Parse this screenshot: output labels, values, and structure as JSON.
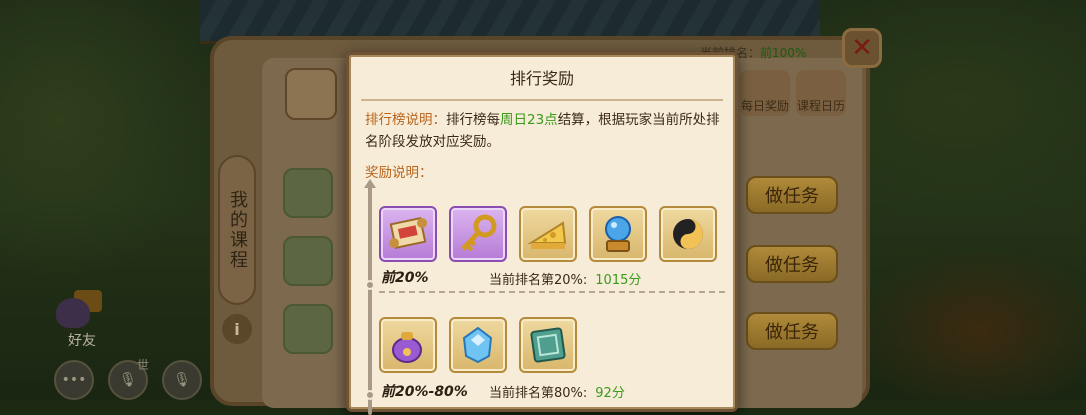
{
  "background": {
    "title_prefix": "当前排名：",
    "title_value": "前100%",
    "tabs": [
      "每日奖励",
      "课程日历"
    ],
    "side_tab_label": "我的课程",
    "info_label": "i",
    "task_button_label": "做任务",
    "friend_label": "好友",
    "world_label": "世"
  },
  "dialog": {
    "title": "排行奖励",
    "desc_label": "排行榜说明：",
    "desc_part1": "排行榜每",
    "desc_highlight": "周日23点",
    "desc_part2": "结算，根据玩家当前所处排名阶段发放对应奖励。",
    "reward_label": "奖励说明："
  },
  "tiers": [
    {
      "name": "前20%",
      "rank_text": "当前排名第20%:",
      "score": "1015分",
      "items": [
        {
          "icon": "scroll-icon",
          "rarity": "purple"
        },
        {
          "icon": "key-icon",
          "rarity": "purple"
        },
        {
          "icon": "cheese-icon",
          "rarity": "gold"
        },
        {
          "icon": "crystal-ball-icon",
          "rarity": "gold"
        },
        {
          "icon": "yin-yang-icon",
          "rarity": "gold"
        }
      ]
    },
    {
      "name": "前20%-80%",
      "rank_text": "当前排名第80%:",
      "score": "92分",
      "items": [
        {
          "icon": "pouch-icon",
          "rarity": "gold"
        },
        {
          "icon": "ice-crystal-icon",
          "rarity": "gold"
        },
        {
          "icon": "tablet-icon",
          "rarity": "gold"
        }
      ]
    }
  ],
  "colors": {
    "label_orange": "#b8641c",
    "highlight_green": "#3b9a1a",
    "dialog_bg": "#f6ecd8"
  }
}
